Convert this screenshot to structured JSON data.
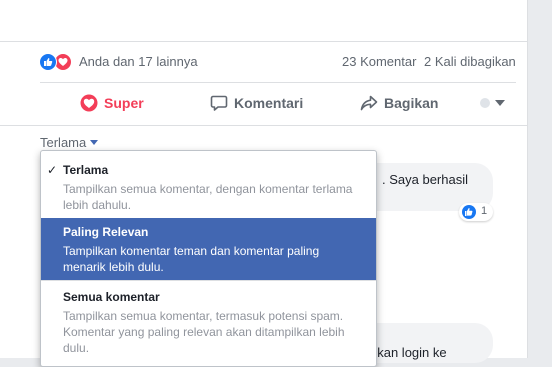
{
  "reactions": {
    "summary": "Anda dan 17 lainnya",
    "comments": "23 Komentar",
    "shares": "2 Kali dibagikan",
    "icons": [
      "like-icon",
      "love-icon"
    ],
    "like_color": "#1877f2",
    "love_color": "#f33e58"
  },
  "actions": {
    "super_label": "Super",
    "comment_label": "Komentari",
    "share_label": "Bagikan"
  },
  "sort": {
    "current_label": "Terlama"
  },
  "menu": {
    "options": [
      {
        "title": "Terlama",
        "desc": "Tampilkan semua komentar, dengan komentar terlama lebih dahulu.",
        "checked": true
      },
      {
        "title": "Paling Relevan",
        "desc": "Tampilkan komentar teman dan komentar paling menarik lebih dulu.",
        "highlighted": true
      },
      {
        "title": "Semua komentar",
        "desc": "Tampilkan semua komentar, termasuk potensi spam. Komentar yang paling relevan akan ditampilkan lebih dulu."
      }
    ],
    "highlight_color": "#4267b2"
  },
  "background_comments": {
    "snippet1": ". Saya berhasil",
    "reaction_count": "1",
    "snippet2": "hkan login ke"
  }
}
